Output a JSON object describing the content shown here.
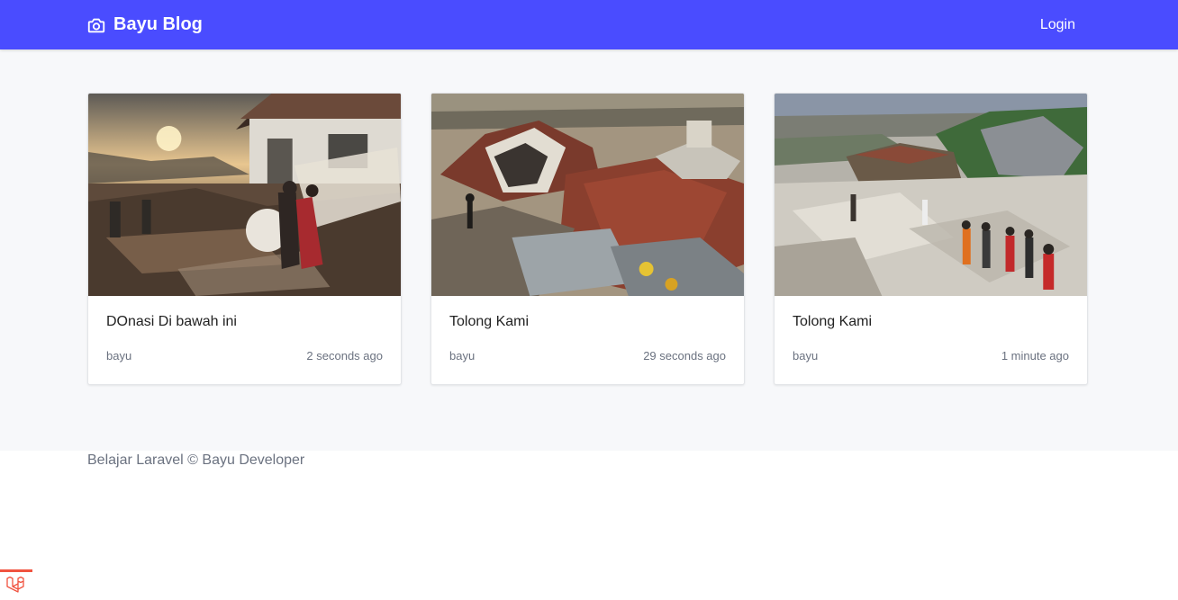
{
  "app": {
    "brand": "Bayu Blog",
    "login_label": "Login",
    "brand_color": "#4a4cff"
  },
  "posts": [
    {
      "title": "DOnasi Di bawah ini",
      "author": "bayu",
      "time": "2 seconds ago",
      "image": "disaster-photo-sunset-village"
    },
    {
      "title": "Tolong Kami",
      "author": "bayu",
      "time": "29 seconds ago",
      "image": "disaster-photo-collapsed-roofs"
    },
    {
      "title": "Tolong Kami",
      "author": "bayu",
      "time": "1 minute ago",
      "image": "disaster-photo-rescuers-rubble"
    }
  ],
  "footer": {
    "text": "Belajar Laravel © Bayu Developer"
  },
  "icons": {
    "brand": "camera-icon",
    "debug": "laravel-logo-icon"
  }
}
